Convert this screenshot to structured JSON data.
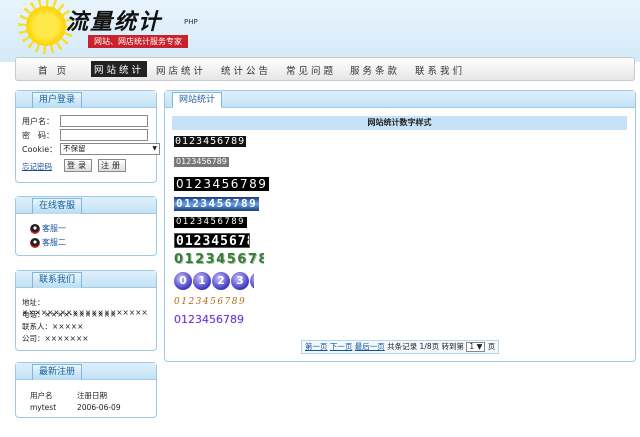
{
  "header": {
    "logo_text": "流量统计",
    "logo_php": "PHP",
    "slogan": "网站、网店统计服务专家"
  },
  "nav": {
    "items": [
      {
        "label": "首 页"
      },
      {
        "label": "网站统计",
        "active": true
      },
      {
        "label": "网店统计"
      },
      {
        "label": "统计公告"
      },
      {
        "label": "常见问题"
      },
      {
        "label": "服务条款"
      },
      {
        "label": "联系我们"
      }
    ]
  },
  "login": {
    "title": "用户登录",
    "username_label": "用户名：",
    "password_label": "密　码：",
    "cookie_label": "Cookie：",
    "cookie_value": "不保留",
    "forgot_link": "忘记密码",
    "login_button": "登录",
    "register_button": "注册"
  },
  "customer_service": {
    "title": "在线客服",
    "items": [
      "客服一",
      "客服二"
    ]
  },
  "contact": {
    "title": "联系我们",
    "lines": [
      "地址：××××××××××××××××××××",
      "电话：××××-×××××××",
      "联系人：×××××",
      "公司：×××××××"
    ]
  },
  "latest_register": {
    "title": "最新注册",
    "header_user": "用户名",
    "header_date": "注册日期",
    "rows": [
      {
        "user": "mytest",
        "date": "2006-06-09"
      }
    ]
  },
  "main": {
    "tab": "网站统计",
    "table_title": "网站统计数字样式",
    "counter_digits": "0123456789",
    "pager": {
      "first": "第一页",
      "next": "下一页",
      "last": "最后一页",
      "total": "共条记录 1/8页",
      "goto_label": "转到第",
      "page_value": "1",
      "page_suffix": "页"
    }
  },
  "colors": {
    "accent": "#1b5f9a",
    "panel_border": "#9fcae6",
    "title_bar": "#c7e2f7",
    "slogan_bg": "#c8232c"
  }
}
